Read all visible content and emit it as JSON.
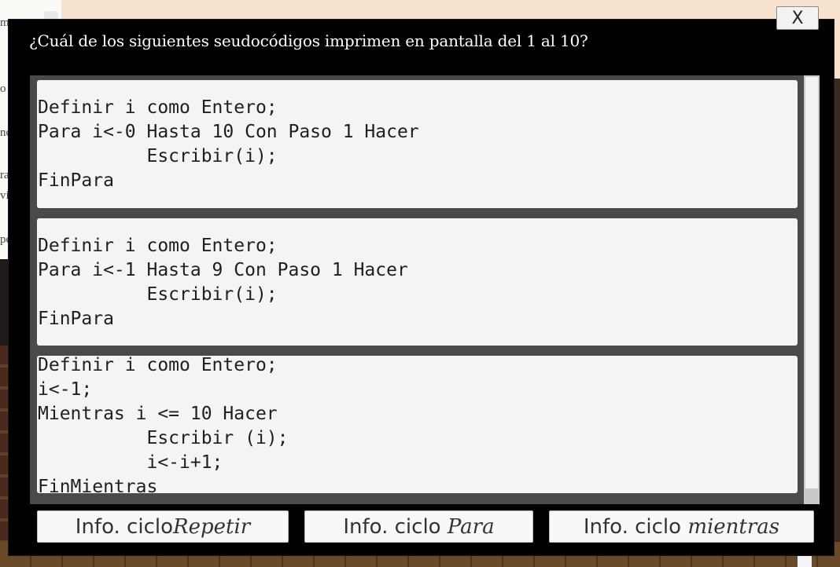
{
  "background": {
    "left_text_fragments": [
      "m",
      "o",
      "no",
      "ra",
      "vi",
      "pe"
    ]
  },
  "dialog": {
    "close_label": "X",
    "question": "¿Cuál de los siguientes seudocódigos imprimen en pantalla del 1 al 10?",
    "options": [
      {
        "code": "Definir i como Entero;\nPara i<-0 Hasta 10 Con Paso 1 Hacer\n          Escribir(i);\nFinPara"
      },
      {
        "code": "Definir i como Entero;\nPara i<-1 Hasta 9 Con Paso 1 Hacer\n          Escribir(i);\nFinPara"
      },
      {
        "code": "Definir i como Entero;\ni<-1;\nMientras i <= 10 Hacer\n          Escribir (i);\n          i<-i+1;\nFinMientras"
      }
    ],
    "info_buttons": {
      "repetir": {
        "prefix": "Info. ciclo",
        "emphasis": "Repetir"
      },
      "para": {
        "prefix": "Info. ciclo ",
        "emphasis": "Para"
      },
      "mientras": {
        "prefix": "Info. ciclo ",
        "emphasis": "mientras"
      }
    }
  }
}
